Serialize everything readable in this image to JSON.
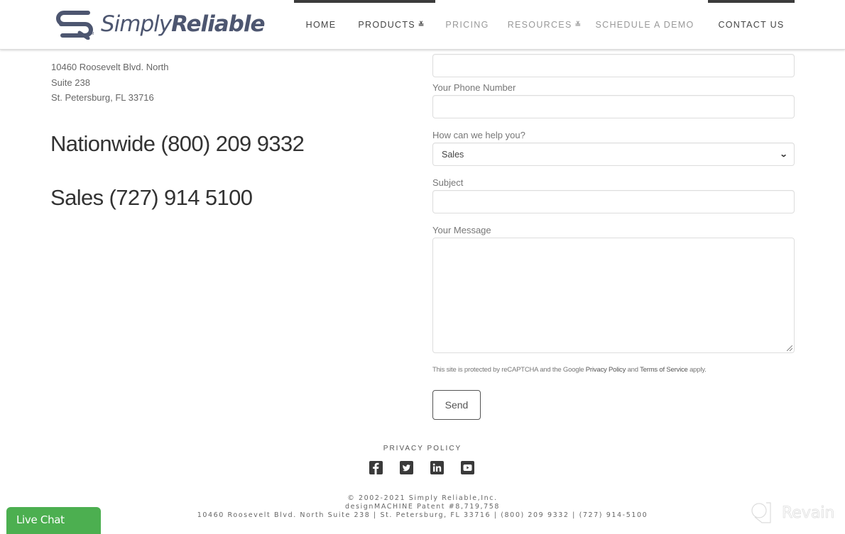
{
  "header": {
    "logo": {
      "text_regular": "Simply",
      "text_bold": "Reliable",
      "tm": "TM"
    },
    "nav": [
      {
        "label": "HOME",
        "active": true,
        "has_dropdown": false
      },
      {
        "label": "PRODUCTS",
        "active": true,
        "has_dropdown": true
      },
      {
        "label": "PRICING",
        "active": false,
        "has_dropdown": false
      },
      {
        "label": "RESOURCES",
        "active": false,
        "has_dropdown": true
      },
      {
        "label": "SCHEDULE A DEMO",
        "active": false,
        "has_dropdown": false
      },
      {
        "label": "CONTACT US",
        "active": true,
        "has_dropdown": false
      }
    ],
    "dropdown_glyph": "≚"
  },
  "contact_info": {
    "address_lines": [
      "10460 Roosevelt Blvd. North",
      "Suite 238",
      "St. Petersburg, FL 33716"
    ],
    "nationwide": "Nationwide (800) 209 9332",
    "sales": "Sales (727) 914 5100"
  },
  "form": {
    "fields": {
      "email": {
        "value": ""
      },
      "phone": {
        "label": "Your Phone Number",
        "value": ""
      },
      "help": {
        "label": "How can we help you?",
        "selected": "Sales"
      },
      "subject": {
        "label": "Subject",
        "value": ""
      },
      "message": {
        "label": "Your Message",
        "value": ""
      }
    },
    "recaptcha": {
      "prefix": "This site is protected by reCAPTCHA and the Google ",
      "privacy_link": "Privacy Policy",
      "middle": " and ",
      "terms_link": "Terms of Service",
      "suffix": " apply."
    },
    "send_label": "Send"
  },
  "footer": {
    "privacy_policy": "PRIVACY POLICY",
    "social": [
      "facebook",
      "twitter",
      "linkedin",
      "youtube"
    ],
    "copyright": "© 2002-2021 Simply Reliable,Inc.",
    "patent": "designMACHINE Patent #8,719,758",
    "address_line": "10460 Roosevelt Blvd. North Suite 238 | St. Petersburg, FL 33716 | (800) 209 9332 | (727) 914-5100"
  },
  "widgets": {
    "live_chat": "Live Chat",
    "revain": "Revain"
  },
  "colors": {
    "brand": "#4d5670",
    "nav_active_bar": "#3b3b3b",
    "live_chat": "#4caf50"
  }
}
